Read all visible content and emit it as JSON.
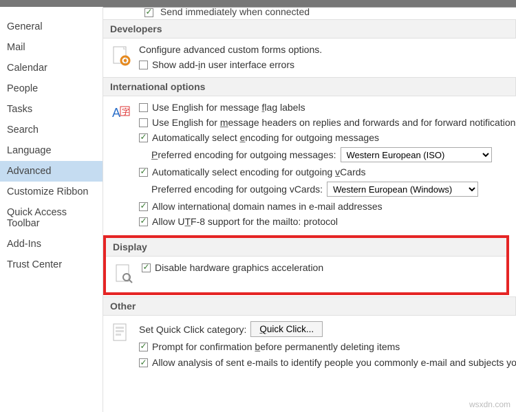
{
  "top_cut": {
    "label": "Send immediately when connected"
  },
  "sidebar": {
    "items": [
      {
        "label": "General"
      },
      {
        "label": "Mail"
      },
      {
        "label": "Calendar"
      },
      {
        "label": "People"
      },
      {
        "label": "Tasks"
      },
      {
        "label": "Search"
      },
      {
        "label": "Language"
      },
      {
        "label": "Advanced",
        "selected": true
      },
      {
        "label": "Customize Ribbon"
      },
      {
        "label": "Quick Access Toolbar"
      },
      {
        "label": "Add-Ins"
      },
      {
        "label": "Trust Center"
      }
    ]
  },
  "sections": {
    "developers": {
      "title": "Developers",
      "forms_text": "Configure advanced custom forms options.",
      "show_addin": {
        "label_pre": "Show add-",
        "u": "i",
        "label_post": "n user interface errors",
        "checked": false
      }
    },
    "international": {
      "title": "International options",
      "flag": {
        "label_pre": "Use English for message ",
        "u": "f",
        "label_post": "lag labels",
        "checked": false
      },
      "headers": {
        "label_pre": "Use English for ",
        "u": "m",
        "label_post": "essage headers on replies and forwards and for forward notification",
        "checked": false
      },
      "auto_out": {
        "label_pre": "Automatically select ",
        "u": "e",
        "label_post": "ncoding for outgoing messages",
        "checked": true
      },
      "pref_out_label": {
        "pre": "",
        "u": "P",
        "post": "referred encoding for outgoing messages:"
      },
      "pref_out_value": "Western European (ISO)",
      "auto_vcard": {
        "label_pre": "Automatically select encoding for outgoing ",
        "u": "v",
        "label_post": "Cards",
        "checked": true
      },
      "pref_vcard_label": {
        "pre": "Preferred encodin",
        "u": "g",
        "post": " for outgoing vCards:"
      },
      "pref_vcard_value": "Western European (Windows)",
      "intl_domain": {
        "label_pre": "Allow internationa",
        "u": "l",
        "label_post": " domain names in e-mail addresses",
        "checked": true
      },
      "utf8": {
        "label_pre": "Allow U",
        "u": "T",
        "label_post": "F-8 support for the mailto: protocol",
        "checked": true
      }
    },
    "display": {
      "title": "Display",
      "disable_hw": {
        "label": "Disable hardware graphics acceleration",
        "checked": true
      }
    },
    "other": {
      "title": "Other",
      "quick_click_label": "Set Quick Click category:",
      "quick_click_btn": {
        "pre": "",
        "u": "Q",
        "post": "uick Click..."
      },
      "prompt_delete": {
        "label_pre": "Prompt for confirmation ",
        "u": "b",
        "label_post": "efore permanently deleting items",
        "checked": true
      },
      "analysis": {
        "checked": true,
        "line": "Allow analysis of sent e-mails to identify people you commonly e-mail and subjects you commonly discuss, and upload this information to the default SharePoint Server."
      }
    }
  },
  "watermark": "wsxdn.com"
}
